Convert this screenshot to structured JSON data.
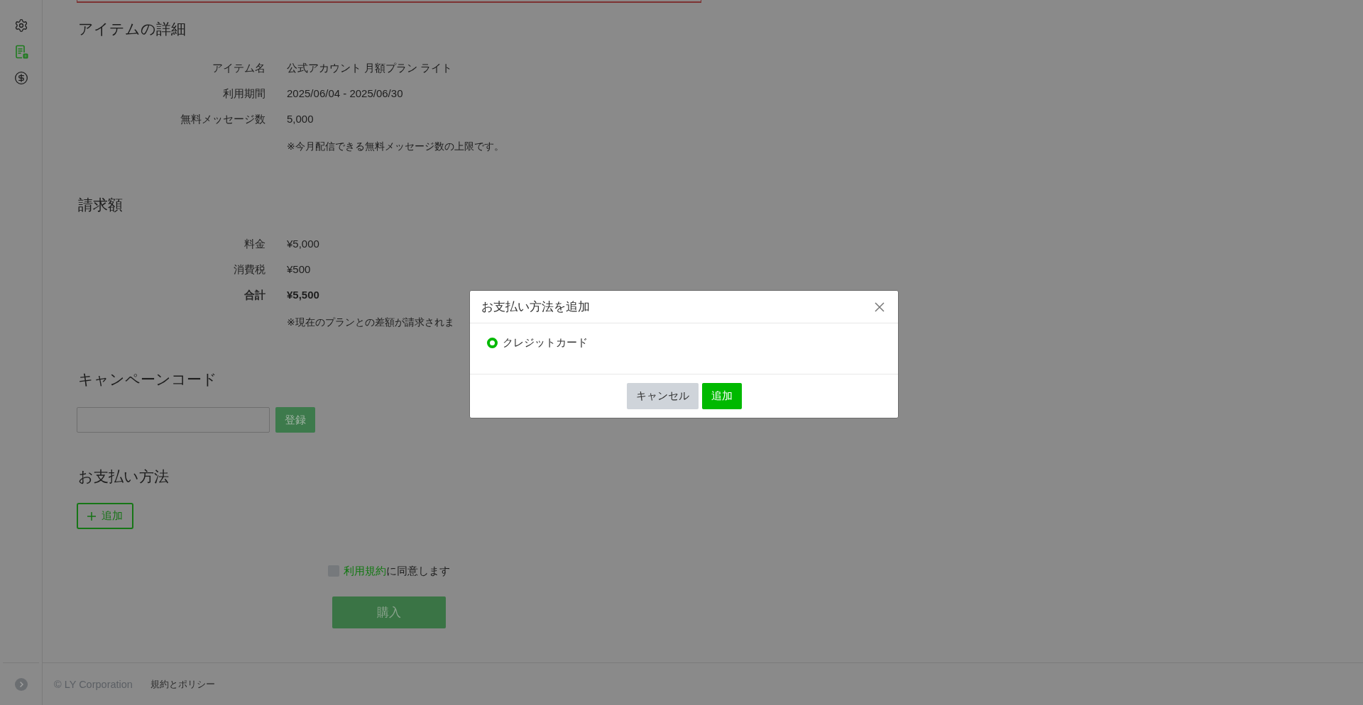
{
  "sidebar": {
    "items": [
      {
        "selected": false
      },
      {
        "selected": true
      },
      {
        "selected": false
      }
    ]
  },
  "item_details": {
    "title": "アイテムの詳細",
    "rows": [
      {
        "label": "アイテム名",
        "value": "公式アカウント 月額プラン ライト"
      },
      {
        "label": "利用期間",
        "value": "2025/06/04 - 2025/06/30"
      },
      {
        "label": "無料メッセージ数",
        "value": "5,000"
      }
    ],
    "note": "※今月配信できる無料メッセージ数の上限です。"
  },
  "billing": {
    "title": "請求額",
    "rows": [
      {
        "label": "料金",
        "value": "¥5,000",
        "kind": "item"
      },
      {
        "label": "消費税",
        "value": "¥500",
        "kind": "item"
      },
      {
        "label": "合計",
        "value": "¥5,500",
        "kind": "total"
      }
    ],
    "note": "※現在のプランとの差額が請求されま"
  },
  "campaign_code": {
    "title": "キャンペーンコード",
    "button": {
      "label": "登録",
      "disabled": true
    }
  },
  "payment_method": {
    "title": "お支払い方法",
    "add_button": "追加"
  },
  "terms": {
    "checked": false,
    "link": "利用規約",
    "text": "に同意します"
  },
  "purchase_button": {
    "label": "購入",
    "disabled": true
  },
  "footer": {
    "copyright": "© LY Corporation",
    "links": [
      "規約とポリシー"
    ]
  },
  "dialog": {
    "title": "お支払い方法を追加",
    "options": [
      {
        "label": "クレジットカード",
        "selected": true
      }
    ],
    "buttons": [
      {
        "label": "キャンセル",
        "kind": "secondary"
      },
      {
        "label": "追加",
        "kind": "primary"
      }
    ]
  }
}
